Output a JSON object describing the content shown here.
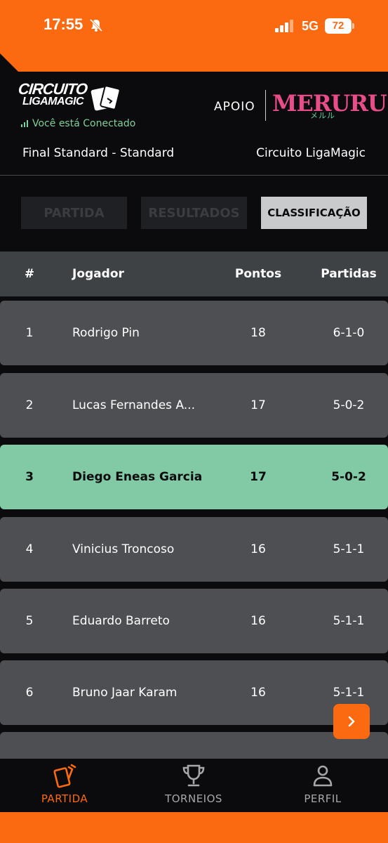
{
  "status_bar": {
    "time": "17:55",
    "network": "5G",
    "battery": "72"
  },
  "header": {
    "logo_line1": "CIRCUITO",
    "logo_line2": "LIGAMAGIC",
    "connection_status": "Você está Conectado",
    "sponsor_label": "APOIO",
    "sponsor_name": "MERURU",
    "sponsor_sub": "メルル",
    "event_name": "Final Standard - Standard",
    "circuit_name": "Circuito LigaMagic"
  },
  "tabs": [
    {
      "label": "PARTIDA",
      "active": false
    },
    {
      "label": "RESULTADOS",
      "active": false
    },
    {
      "label": "CLASSIFICAÇÃO",
      "active": true
    }
  ],
  "table": {
    "columns": [
      "#",
      "Jogador",
      "Pontos",
      "Partidas"
    ],
    "rows": [
      {
        "rank": "1",
        "player": "Rodrigo Pin",
        "points": "18",
        "record": "6-1-0",
        "highlight": false
      },
      {
        "rank": "2",
        "player": "Lucas Fernandes A...",
        "points": "17",
        "record": "5-0-2",
        "highlight": false
      },
      {
        "rank": "3",
        "player": "Diego Eneas Garcia",
        "points": "17",
        "record": "5-0-2",
        "highlight": true
      },
      {
        "rank": "4",
        "player": "Vinicius Troncoso",
        "points": "16",
        "record": "5-1-1",
        "highlight": false
      },
      {
        "rank": "5",
        "player": "Eduardo Barreto",
        "points": "16",
        "record": "5-1-1",
        "highlight": false
      },
      {
        "rank": "6",
        "player": "Bruno Jaar Karam",
        "points": "16",
        "record": "5-1-1",
        "highlight": false
      },
      {
        "rank": "",
        "player": "",
        "points": "",
        "record": "",
        "highlight": false
      }
    ]
  },
  "fab_icon": "chevron-right-icon",
  "bottom_nav": [
    {
      "label": "PARTIDA",
      "icon": "cards-icon",
      "active": true
    },
    {
      "label": "TORNEIOS",
      "icon": "trophy-icon",
      "active": false
    },
    {
      "label": "PERFIL",
      "icon": "person-icon",
      "active": false
    }
  ],
  "colors": {
    "accent": "#fb6a10",
    "highlight_row": "#82c9a6",
    "row_bg": "#4d4f52",
    "connected": "#7fd09b",
    "sponsor": "#e84d8a"
  }
}
